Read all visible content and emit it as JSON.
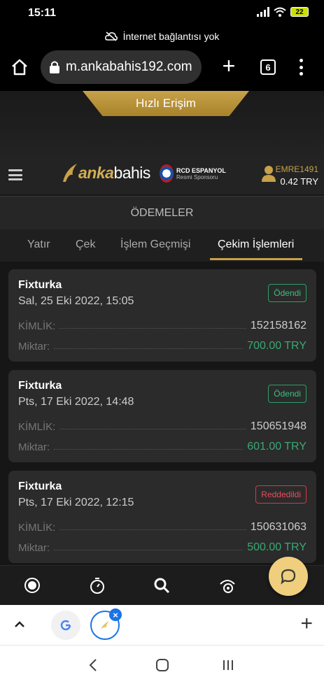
{
  "status_bar": {
    "time": "15:11",
    "battery": "22"
  },
  "offline_notice": "İnternet bağlantısı yok",
  "browser": {
    "url": "m.ankabahis192.com",
    "tab_count": "6"
  },
  "quick_access": "Hızlı Erişim",
  "header": {
    "logo_bold": "anka",
    "logo_rest": "bahis",
    "sponsor_name": "RCD ESPANYOL",
    "sponsor_sub": "Resmi Sponsoru",
    "username": "EMRE1491",
    "balance": "0.42 TRY"
  },
  "section_title": "ÖDEMELER",
  "tabs": [
    {
      "label": "Yatır"
    },
    {
      "label": "Çek"
    },
    {
      "label": "İşlem Geçmişi"
    },
    {
      "label": "Çekim İşlemleri"
    }
  ],
  "labels": {
    "id": "KİMLİK:",
    "amount": "Miktar:"
  },
  "transactions": [
    {
      "provider": "Fixturka",
      "date": "Sal, 25 Eki 2022, 15:05",
      "status": "Ödendi",
      "id": "152158162",
      "amount": "700.00 TRY"
    },
    {
      "provider": "Fixturka",
      "date": "Pts, 17 Eki 2022, 14:48",
      "status": "Ödendi",
      "id": "150651948",
      "amount": "601.00 TRY"
    },
    {
      "provider": "Fixturka",
      "date": "Pts, 17 Eki 2022, 12:15",
      "status": "Reddedildi",
      "id": "150631063",
      "amount": "500.00 TRY"
    }
  ],
  "colors": {
    "gold": "#c8a14a",
    "paid": "#3cc07f",
    "rejected": "#f04b5c",
    "chat": "#efcf7d"
  },
  "icons": [
    "home-icon",
    "lock-icon",
    "plus-icon",
    "menu-icon",
    "user-icon",
    "live-icon",
    "stopwatch-icon",
    "search-icon",
    "casino-icon",
    "chat-icon",
    "google-icon",
    "chevron-up-icon",
    "back-icon",
    "recents-icon"
  ]
}
